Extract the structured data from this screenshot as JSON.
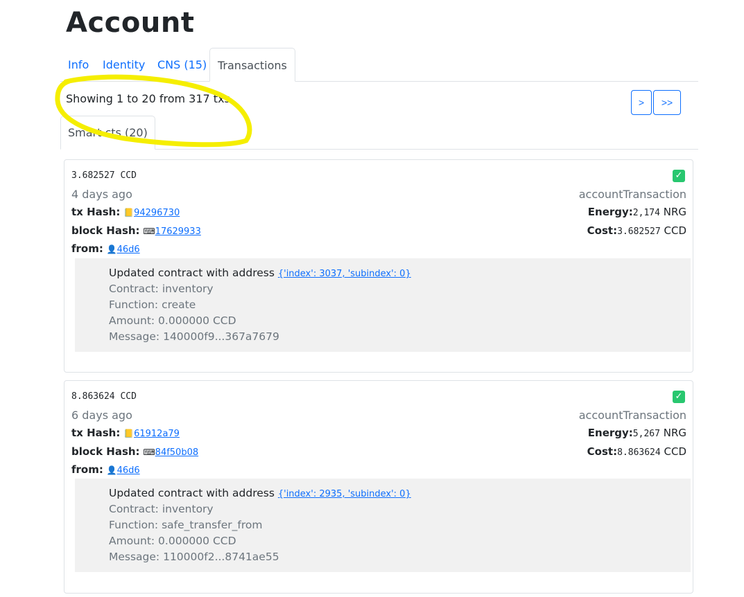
{
  "page": {
    "title": "Account"
  },
  "tabs": [
    "Info",
    "Identity",
    "CNS (15)",
    "Transactions"
  ],
  "showing_text": "Showing 1 to 20 from 317 txs",
  "pager": {
    "next": ">",
    "last": ">>"
  },
  "subtab": "Smart cts (20)",
  "labels": {
    "tx_hash": "tx Hash:",
    "block_hash": "block Hash:",
    "from": "from:",
    "energy": "Energy:",
    "cost": "Cost:"
  },
  "icons": {
    "tx": "notebook-icon",
    "block": "keyboard-icon",
    "from": "user-icon",
    "status": "check-icon"
  },
  "colors": {
    "link": "#0d6efd",
    "success": "#28c76f",
    "highlight": "#f5ee00"
  },
  "transactions": [
    {
      "amount": "3.682527 CCD",
      "ago": "4 days ago",
      "type": "accountTransaction",
      "tx_hash": "94296730",
      "block_hash": "17629933",
      "from": "46d6",
      "energy_value": "2,174",
      "energy_unit": "NRG",
      "cost_value": "3.682527",
      "cost_unit": "CCD",
      "summary_prefix": "Updated contract with address ",
      "address": "{'index': 3037, 'subindex': 0}",
      "contract": "Contract: inventory",
      "function": "Function: create",
      "tx_amount": "Amount: 0.000000 CCD",
      "message": "Message: 140000f9...367a7679"
    },
    {
      "amount": "8.863624 CCD",
      "ago": "6 days ago",
      "type": "accountTransaction",
      "tx_hash": "61912a79",
      "block_hash": "84f50b08",
      "from": "46d6",
      "energy_value": "5,267",
      "energy_unit": "NRG",
      "cost_value": "8.863624",
      "cost_unit": "CCD",
      "summary_prefix": "Updated contract with address ",
      "address": "{'index': 2935, 'subindex': 0}",
      "contract": "Contract: inventory",
      "function": "Function: safe_transfer_from",
      "tx_amount": "Amount: 0.000000 CCD",
      "message": "Message: 110000f2...8741ae55"
    }
  ]
}
